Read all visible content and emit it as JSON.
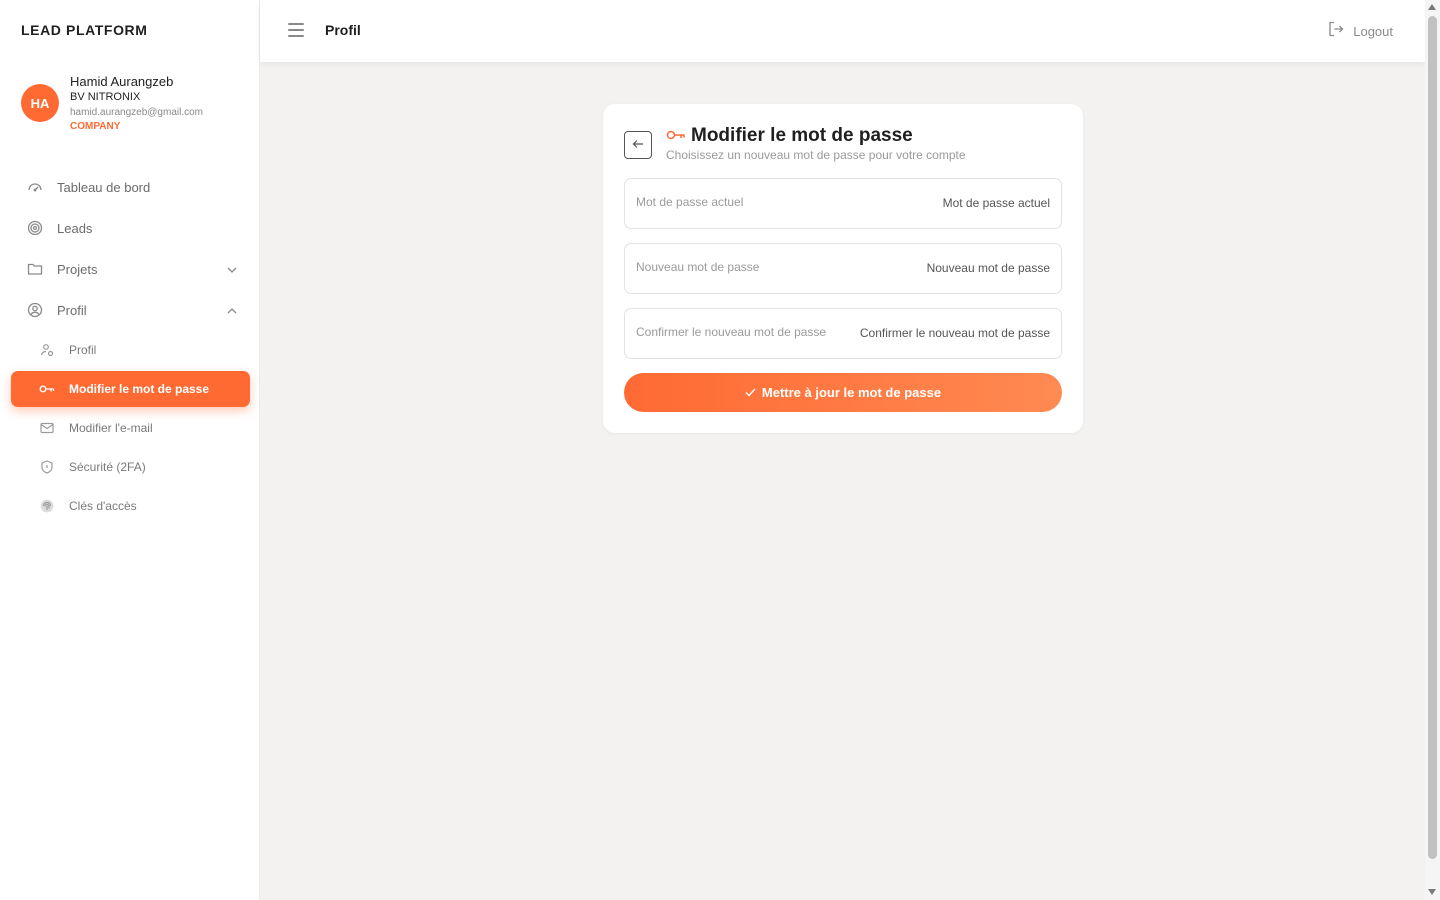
{
  "brand": "LEAD PLATFORM",
  "user": {
    "initials": "HA",
    "name": "Hamid Aurangzeb",
    "company": "BV NITRONIX",
    "email": "hamid.aurangzeb@gmail.com",
    "role": "COMPANY"
  },
  "nav": {
    "dashboard": "Tableau de bord",
    "leads": "Leads",
    "projects": "Projets",
    "profile": "Profil",
    "sub": {
      "profile": "Profil",
      "change_password": "Modifier le mot de passe",
      "change_email": "Modifier l'e-mail",
      "security": "Sécurité (2FA)",
      "access_keys": "Clés d'accès"
    }
  },
  "topbar": {
    "title": "Profil",
    "logout": "Logout"
  },
  "card": {
    "title": "Modifier le mot de passe",
    "subtitle": "Choisissez un nouveau mot de passe pour votre compte",
    "fields": [
      {
        "label": "Mot de passe actuel",
        "placeholder": "Mot de passe actuel",
        "value": ""
      },
      {
        "label": "Nouveau mot de passe",
        "placeholder": "Nouveau mot de passe",
        "value": ""
      },
      {
        "label": "Confirmer le nouveau mot de passe",
        "placeholder": "Confirmer le nouveau mot de passe",
        "value": ""
      }
    ],
    "submit": "Mettre à jour le mot de passe"
  },
  "colors": {
    "accent": "#ff6a33",
    "background": "#f3f2f0"
  },
  "icons": {
    "dashboard": "gauge-icon",
    "leads": "target-icon",
    "projects": "folder-icon",
    "profile": "user-circle-icon",
    "sub_profile": "user-settings-icon",
    "change_password": "key-icon",
    "change_email": "envelope-icon",
    "security": "shield-icon",
    "access_keys": "fingerprint-icon",
    "logout": "logout-icon",
    "back": "arrow-left-icon",
    "submit": "check-icon"
  }
}
